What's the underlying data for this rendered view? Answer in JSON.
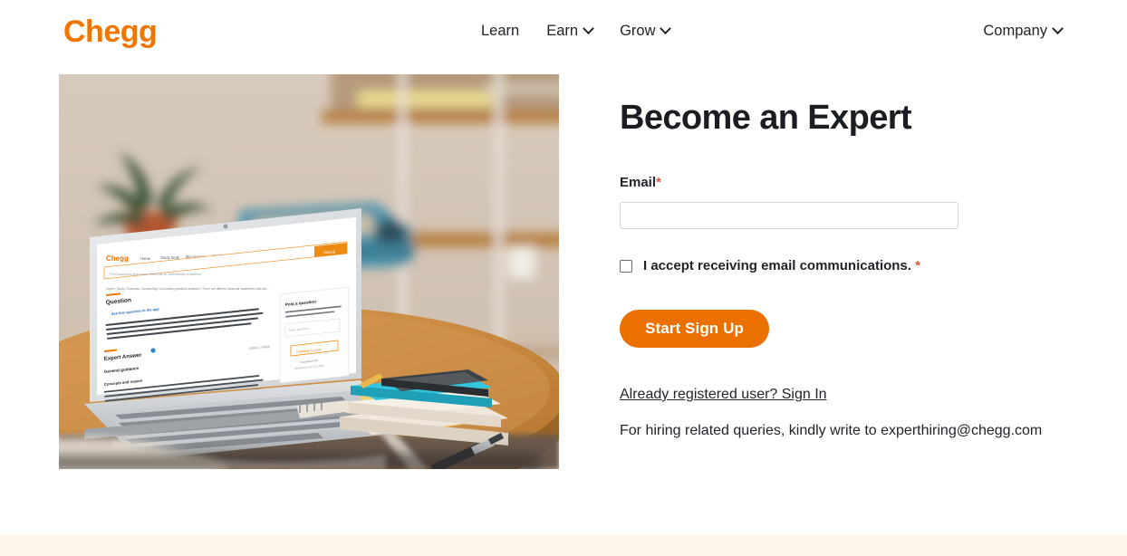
{
  "header": {
    "logo_text": "Chegg",
    "logo_color": "#ee7500",
    "nav_center": [
      {
        "label": "Learn",
        "has_caret": false
      },
      {
        "label": "Earn",
        "has_caret": true
      },
      {
        "label": "Grow",
        "has_caret": true
      }
    ],
    "nav_right": {
      "label": "Company",
      "has_caret": true
    }
  },
  "hero_image": {
    "alt": "Laptop on a round wooden table showing the Chegg study page, with books, a phone, sticky notes and a pen; blurred shelves with a plant and blue typewriter in the background",
    "laptop_screen": {
      "brand": "Chegg",
      "nav": [
        "Home",
        "Study tools",
        "My courses",
        "My books",
        "Career",
        "Sell"
      ],
      "search_placeholder": "Find solutions from your textbook or homework problems",
      "search_button": "Search",
      "breadcrumb": "Home / Study / Business / Accounting / Accounting question answers / There are different financial statements that are...",
      "question_heading": "Question",
      "post_label": "See this question in the app",
      "answer_heading": "Expert Answer",
      "rating_text": "100% (1 rating)",
      "guidance_heading": "General guidance",
      "concepts_heading": "Concepts and reason",
      "sidebar_heading": "Post a question",
      "sidebar_text": "Answers from our experts for your tough homework questions",
      "sidebar_input_placeholder": "Enter question",
      "sidebar_button": "Continue to post",
      "sidebar_note": "1 question left",
      "sidebar_renew": "Renews on Jun 26, 2021"
    }
  },
  "form": {
    "title": "Become an Expert",
    "email_label": "Email",
    "required_mark": "*",
    "email_value": "",
    "email_placeholder": "",
    "consent_label": "I accept receiving email communications.",
    "consent_checked": false,
    "submit_label": "Start Sign Up",
    "submit_color": "#ea7000",
    "signin_link": "Already registered user? Sign In",
    "hiring_note": "For hiring related queries, kindly write to experthiring@chegg.com"
  },
  "bottom_band_color": "#fdf6ec"
}
